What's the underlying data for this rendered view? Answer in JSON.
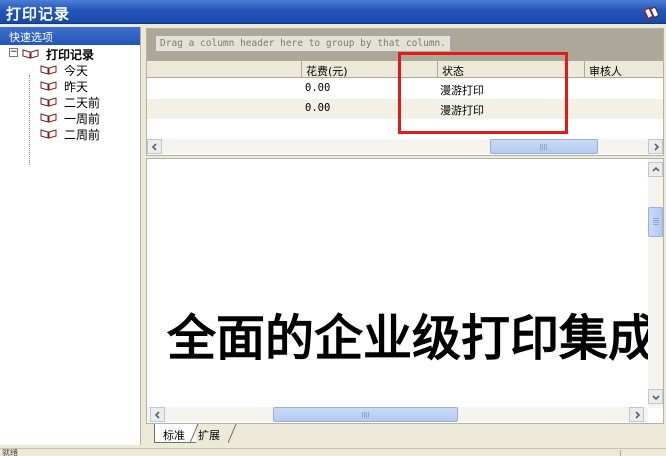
{
  "window": {
    "title": "打印记录",
    "title_icon": "books-icon"
  },
  "left_panel": {
    "header": "快速选项",
    "tree": {
      "root": {
        "label": "打印记录",
        "expander": "⊟"
      },
      "children": [
        {
          "label": "今天"
        },
        {
          "label": "昨天"
        },
        {
          "label": "二天前"
        },
        {
          "label": "一周前"
        },
        {
          "label": "二周前"
        }
      ]
    }
  },
  "grid": {
    "group_hint": "Drag a column header here to group by that column.",
    "columns": [
      {
        "label": "花费(元)"
      },
      {
        "label": "状态"
      },
      {
        "label": "审核人"
      }
    ],
    "rows": [
      {
        "cost": "0.00",
        "status": "漫游打印"
      },
      {
        "cost": "0.00",
        "status": "漫游打印"
      }
    ]
  },
  "preview": {
    "banner_text": "全面的企业级打印集成"
  },
  "tabs": [
    {
      "label": "标准",
      "active": true
    },
    {
      "label": "扩展",
      "active": false
    }
  ],
  "status_bar": {
    "text": "就绪"
  },
  "colors": {
    "title_bar": "#2456b9",
    "highlight_box": "#e21a1a",
    "window_bg": "#ece9d8"
  }
}
